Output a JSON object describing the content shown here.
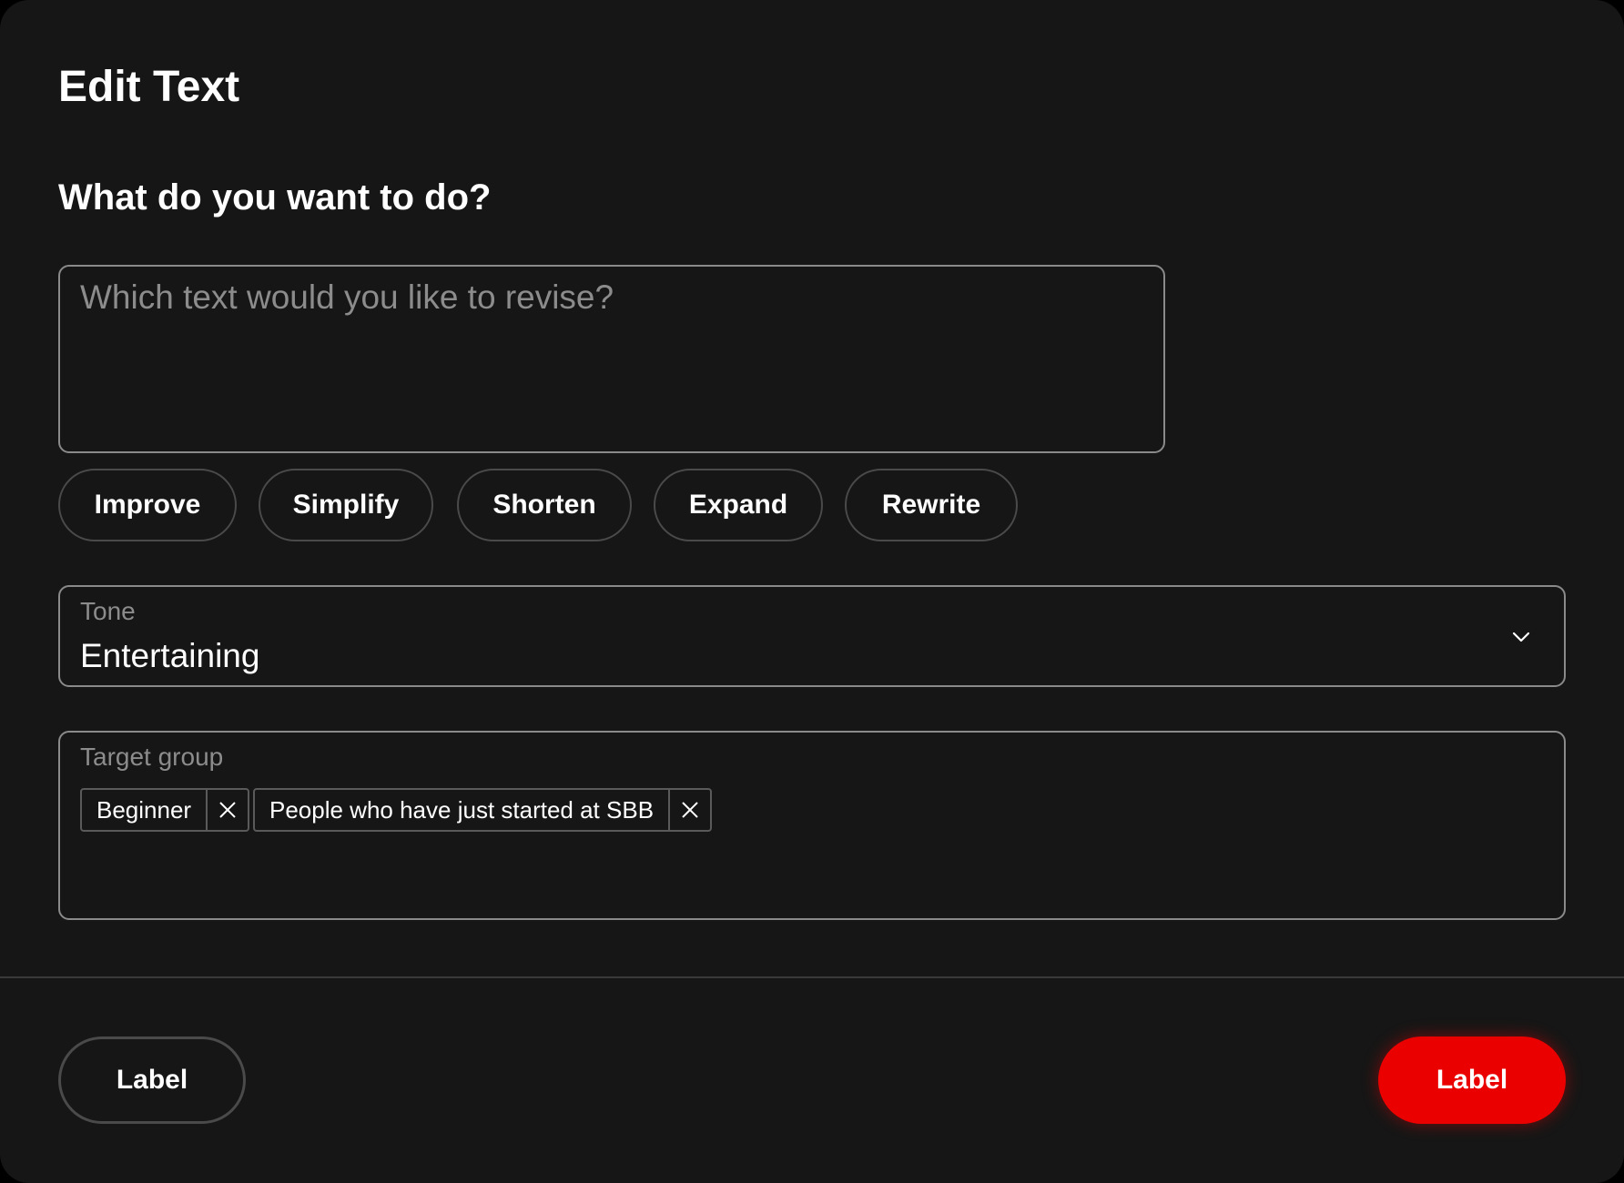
{
  "dialog": {
    "title": "Edit Text",
    "question": "What do you want to do?"
  },
  "prompt": {
    "placeholder": "Which text would you like to revise?",
    "value": ""
  },
  "actions": [
    {
      "label": "Improve"
    },
    {
      "label": "Simplify"
    },
    {
      "label": "Shorten"
    },
    {
      "label": "Expand"
    },
    {
      "label": "Rewrite"
    }
  ],
  "tone": {
    "label": "Tone",
    "value": "Entertaining",
    "icon": "chevron-down-icon"
  },
  "target_group": {
    "label": "Target group",
    "tags": [
      {
        "label": "Beginner",
        "remove_icon": "close-icon"
      },
      {
        "label": "People who have just started at SBB",
        "remove_icon": "close-icon"
      }
    ]
  },
  "footer": {
    "secondary_label": "Label",
    "primary_label": "Label"
  },
  "colors": {
    "background": "#161616",
    "primary": "#eb0000",
    "border": "#8a8a8a",
    "muted_text": "#8c8c8c"
  }
}
